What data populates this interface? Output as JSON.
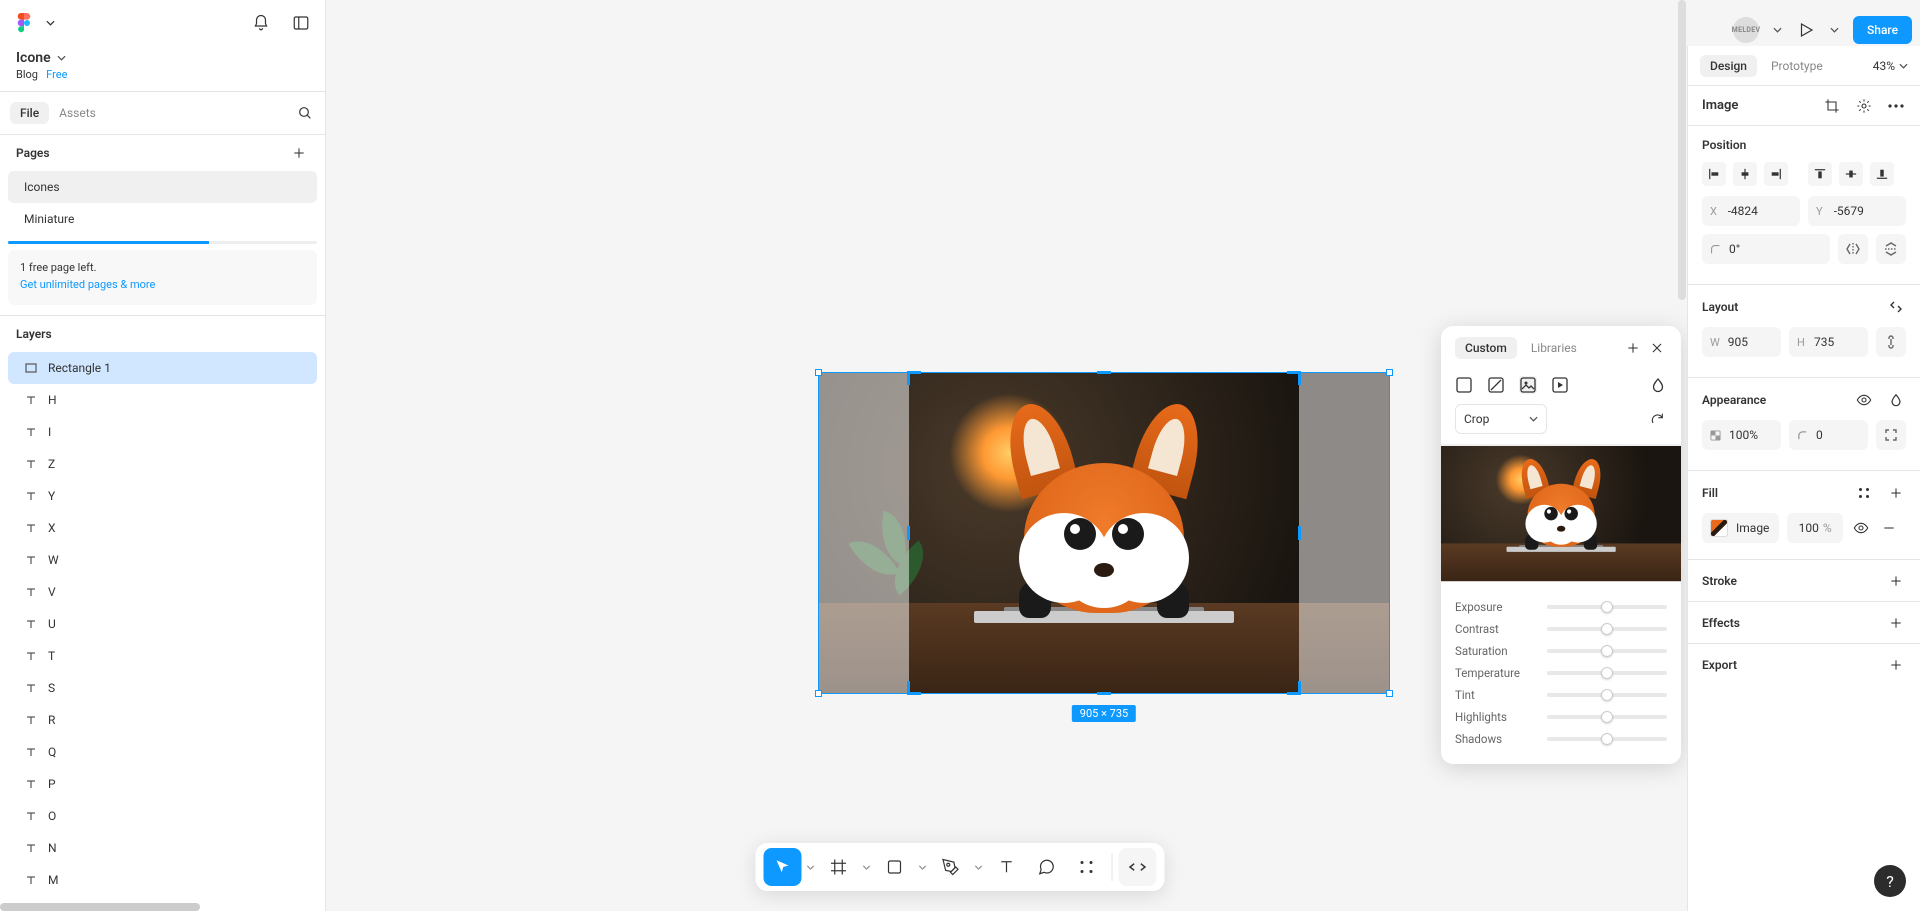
{
  "file": {
    "name": "Icone",
    "workspace": "Blog",
    "plan": "Free"
  },
  "left_tabs": {
    "file": "File",
    "assets": "Assets"
  },
  "pages": {
    "header": "Pages",
    "items": [
      "Icones",
      "Miniature"
    ],
    "active_index": 0,
    "promo_line1": "1 free page left.",
    "promo_link": "Get unlimited pages & more"
  },
  "layers": {
    "header": "Layers",
    "items": [
      "Rectangle 1",
      "H",
      "I",
      "Z",
      "Y",
      "X",
      "W",
      "V",
      "U",
      "T",
      "S",
      "R",
      "Q",
      "P",
      "O",
      "N",
      "M"
    ],
    "selected_index": 0
  },
  "canvas": {
    "dim_label": "905 × 735"
  },
  "fill_popup": {
    "tabs": {
      "custom": "Custom",
      "libraries": "Libraries"
    },
    "mode": "Crop",
    "sliders": [
      "Exposure",
      "Contrast",
      "Saturation",
      "Temperature",
      "Tint",
      "Highlights",
      "Shadows"
    ]
  },
  "top_right": {
    "avatar_initials": "MELDEV",
    "share": "Share"
  },
  "right_panel": {
    "tabs": {
      "design": "Design",
      "prototype": "Prototype"
    },
    "zoom": "43%",
    "element_title": "Image",
    "position": {
      "header": "Position",
      "x": "-4824",
      "y": "-5679",
      "rotation": "0°"
    },
    "layout": {
      "header": "Layout",
      "w": "905",
      "h": "735"
    },
    "appearance": {
      "header": "Appearance",
      "opacity": "100%",
      "corner": "0"
    },
    "fill": {
      "header": "Fill",
      "label": "Image",
      "pct": "100",
      "unit": "%"
    },
    "stroke": "Stroke",
    "effects": "Effects",
    "export": "Export"
  },
  "toolbar": {
    "tools": [
      "move",
      "frame",
      "shape",
      "pen",
      "text",
      "comment",
      "actions",
      "dev"
    ]
  },
  "icons": {
    "chevron_down": "chevron-down-icon"
  }
}
